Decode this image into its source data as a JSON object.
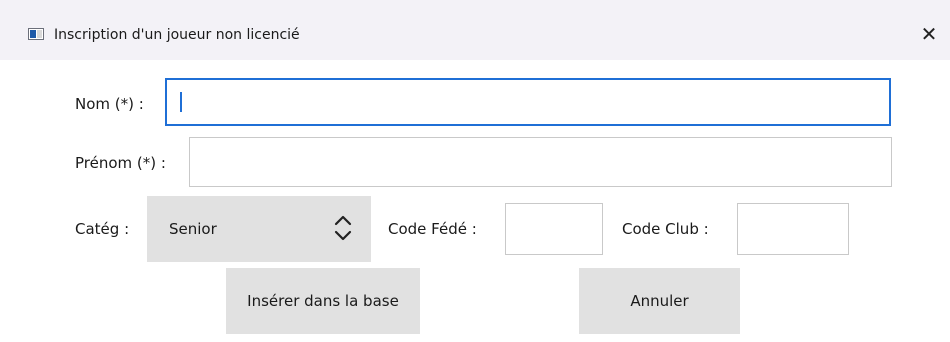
{
  "window": {
    "title": "Inscription d'un joueur non licencié",
    "close_glyph": "✕",
    "icon": "app-window-icon"
  },
  "form": {
    "nom_label": "Nom (*) :",
    "nom_value": "",
    "prenom_label": "Prénom (*) :",
    "prenom_value": "",
    "categ_label": "Catég :",
    "categ_selected": "Senior",
    "code_fede_label": "Code Fédé :",
    "code_fede_value": "",
    "code_club_label": "Code Club :",
    "code_club_value": ""
  },
  "buttons": {
    "insert_label": "Insérer dans la base",
    "cancel_label": "Annuler"
  },
  "colors": {
    "titlebar_bg": "#f3f2f7",
    "focus_border": "#1f6fd6",
    "control_bg": "#e1e1e1"
  }
}
